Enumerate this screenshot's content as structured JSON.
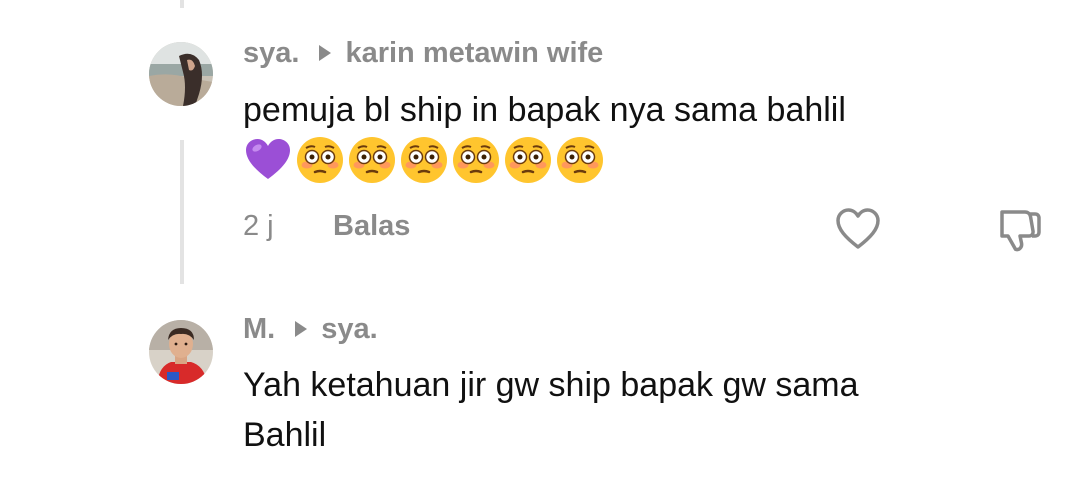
{
  "comments": [
    {
      "author": "sya.",
      "reply_to": "karin metawin wife",
      "text_line1": "pemuja bl ship in bapak nya sama bahlil",
      "emojis": [
        "purple-heart",
        "flushed-face",
        "flushed-face",
        "flushed-face",
        "flushed-face",
        "flushed-face",
        "flushed-face"
      ],
      "time": "2 j",
      "reply_label": "Balas",
      "icons": {
        "like": "heart-outline-icon",
        "dislike": "thumbs-down-icon"
      }
    },
    {
      "author": "M.",
      "reply_to": "sya.",
      "text_line1": "Yah ketahuan jir gw ship bapak gw sama",
      "text_line2": "Bahlil"
    }
  ],
  "colors": {
    "meta_gray": "#8a8a8a",
    "text": "#111111",
    "thread_line": "#e3e3e3",
    "emoji_heart": "#9b4fd6",
    "emoji_face": "#ffc52e"
  }
}
